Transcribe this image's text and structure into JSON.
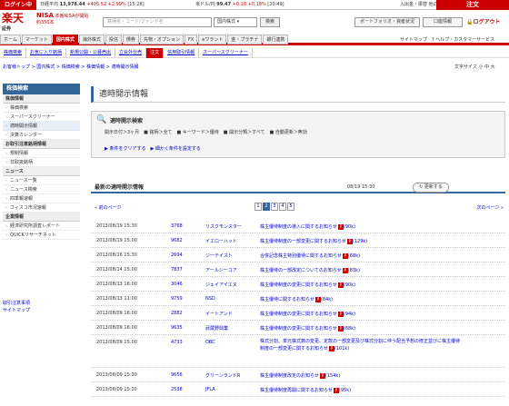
{
  "topbar": {
    "login": "ログイン中",
    "ticker": [
      {
        "label": "日経平均",
        "value": "13,978.44",
        "change": "+405.52",
        "pct": "+2.99%",
        "time": "[15:28]"
      },
      {
        "label": "米ドル/円",
        "value": "99.47",
        "change": "+0.18",
        "pct": "+0.18%",
        "time": "[20:49]"
      }
    ],
    "right_text": "入出金・振替 他の画面",
    "order": "注文"
  },
  "header": {
    "logo": "楽天",
    "logo_sub": "証券",
    "nisa_title": "NISA",
    "nisa_text": "本番NISAが開始",
    "nisa_sub": "約350本",
    "search_placeholder": "銘柄名・コード/ファンド名",
    "select_value": "国内株式",
    "search_button": "検索",
    "portfolio_button": "ポートフォリオ・資産状況",
    "account_button": "口座情報",
    "logout": "ログアウト"
  },
  "nav": {
    "items": [
      "ホーム",
      "マーケット",
      "国内株式",
      "海外株式",
      "投信",
      "債券",
      "先物・オプション",
      "FX",
      "eワラント",
      "金・プラチナ",
      "銀行連携"
    ],
    "active_index": 2,
    "sitemap": "サイトマップ",
    "help": "ヘルプ・カスタマーサービス"
  },
  "subnav": {
    "items": [
      "株価検索",
      "お気に入り銘柄",
      "新規公開・公募売出",
      "立会外分売",
      "注文",
      "信用取引情報",
      "スーパースクリーナー"
    ],
    "active_index": 4
  },
  "breadcrumb": "お客様トップ > 国内株式 > 株価検索 > 株価情報 > 適時開示情報",
  "font_size": "文字サイズ 小 中 大",
  "sidebar": {
    "head": "株価検索",
    "sections": [
      {
        "title": "株価情報",
        "items": [
          "株価検索",
          "スーパースクリーナー",
          "適時開示情報",
          "決算カレンダー"
        ],
        "active": 2
      },
      {
        "title": "お取引注意銘柄情報",
        "items": [
          "規制情報",
          "非取扱銘柄"
        ],
        "active": -1
      },
      {
        "title": "ニュース",
        "items": [
          "ニュース一覧",
          "ニュース検索",
          "四季報速報",
          "フィスコ市況速報"
        ],
        "active": -1
      },
      {
        "title": "企業情報",
        "items": [
          "経済研究所調査レポート",
          "QUICKリサーチネット"
        ],
        "active": -1
      }
    ],
    "links": [
      "取引注意事項",
      "サイトマップ"
    ]
  },
  "page_title": "適時開示情報",
  "search_panel": {
    "title": "適時開示検索",
    "conditions": "開示日付＞3ヶ月　■ 銘柄＞全て　■ キーワード＞優待　■ 開示分類＞すべて　■ 自動更新＞無効",
    "clear": "条件をクリアする",
    "detail": "細かく条件を設定する"
  },
  "list": {
    "title": "最新の適時開示情報",
    "date": "08/19 15:30",
    "update_button": "更新する",
    "prev": "前のページ",
    "next": "次のページ",
    "pages": [
      "1",
      "2",
      "3",
      "4",
      "5"
    ],
    "current_page_index": 1,
    "rows": [
      {
        "date": "2013/08/19 15:30",
        "code": "3768",
        "name": "リスクモンスター",
        "title": "株主優待制度の導入に関するお知らせ",
        "size": "(90k)"
      },
      {
        "date": "2013/08/19 15:00",
        "code": "9682",
        "name": "イエローハット",
        "title": "株主優待制度の一部変更に関するお知らせ",
        "size": "(129k)"
      },
      {
        "date": "2013/08/16 15:30",
        "code": "2694",
        "name": "ジーテイスト",
        "title": "合併記念株主特別優待に関するお知らせ",
        "size": "(68k)"
      },
      {
        "date": "2013/08/14 15:00",
        "code": "7837",
        "name": "アールシーコア",
        "title": "株主優待の一部改定についてのお知らせ",
        "size": "(83k)"
      },
      {
        "date": "2013/08/13 16:00",
        "code": "3046",
        "name": "ジェイアイエヌ",
        "title": "株主優待制度の変更に関するお知らせ",
        "size": "(90k)"
      },
      {
        "date": "2013/08/13 11:00",
        "code": "9759",
        "name": "NSD",
        "title": "株主優待に関するお知らせ",
        "size": "(84k)"
      },
      {
        "date": "2013/08/09 16:00",
        "code": "2882",
        "name": "イートアンド",
        "title": "株主優待制度の変更に関するお知らせ",
        "size": "(94k)"
      },
      {
        "date": "2013/08/09 16:00",
        "code": "9635",
        "name": "武蔵野興業",
        "title": "株主優待制度の変更に関するお知らせ",
        "size": "(68k)"
      },
      {
        "date": "2013/08/09 15:00",
        "code": "4733",
        "name": "OBC",
        "title": "株式分割、単元株式数の変更、定款の一部変更及び株式分割に伴う配当予想の修正並びに株主優待制度の一部変更に関するお知らせ",
        "size": "(101k)",
        "tall": true
      },
      {
        "date": "2013/08/09 15:30",
        "code": "9656",
        "name": "グリーンランドR",
        "title": "株主優待制度改定のお知らせ",
        "size": "(154k)"
      },
      {
        "date": "2013/08/09 15:20",
        "code": "2538",
        "name": "JFLA",
        "title": "株主優待制度再開に関するお知らせ",
        "size": "(95k)"
      }
    ]
  },
  "colors": {
    "brand": "#cc0000",
    "accent": "#336699",
    "link": "#0000cc"
  }
}
